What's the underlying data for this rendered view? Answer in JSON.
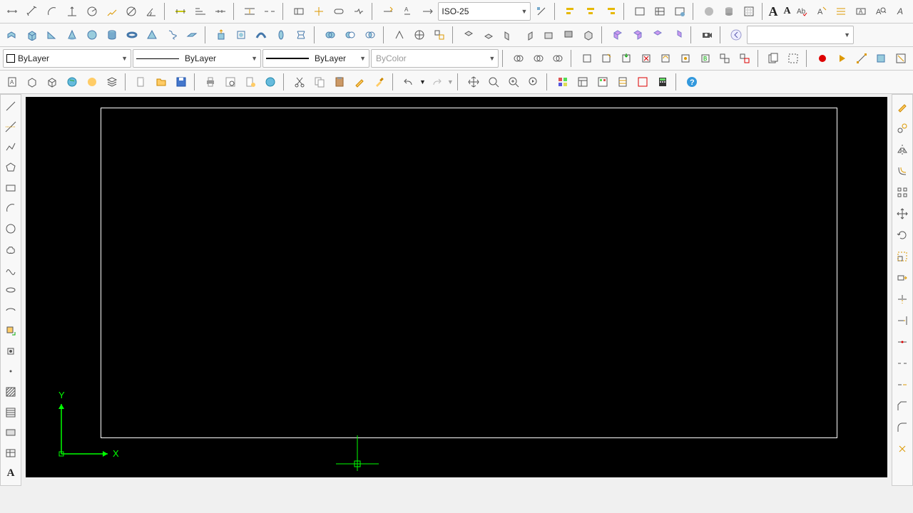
{
  "dimstyle": {
    "current": "ISO-25"
  },
  "layer_combo": {
    "label": "ByLayer"
  },
  "linetype_combo": {
    "label": "ByLayer"
  },
  "lineweight_combo": {
    "label": "ByLayer"
  },
  "plotstyle_combo": {
    "label": "ByColor"
  },
  "search": {
    "placeholder": ""
  },
  "ucs": {
    "x": "X",
    "y": "Y"
  },
  "text_sample": "A"
}
